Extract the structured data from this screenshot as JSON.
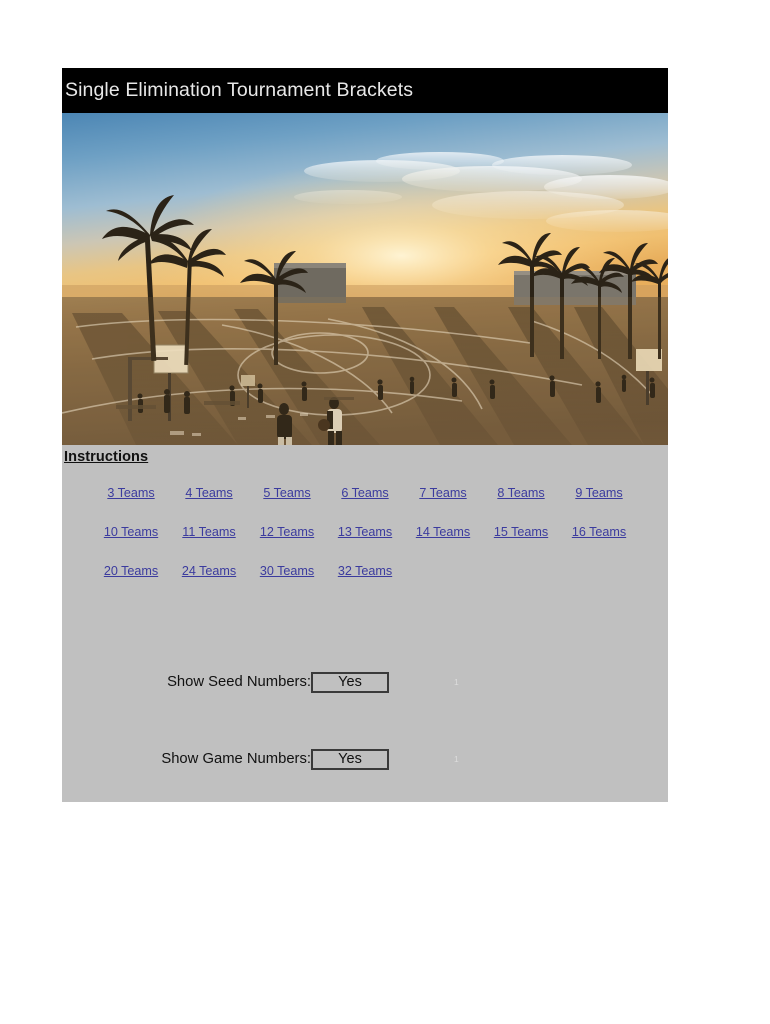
{
  "document": {
    "title": "Single Elimination Tournament Brackets",
    "background_color": "#ffffff",
    "panel_color": "#c0c0c0",
    "title_bar_color": "#000000",
    "link_color": "#3b3b9e"
  },
  "hero": {
    "alt": "Outdoor beach basketball courts at sunset with tall palm trees, long shadows across the asphalt and players on the court"
  },
  "instructions": {
    "label": "Instructions"
  },
  "bracket_links": [
    [
      {
        "label": "3 Teams"
      },
      {
        "label": "4 Teams"
      },
      {
        "label": "5 Teams"
      },
      {
        "label": "6 Teams"
      },
      {
        "label": "7 Teams"
      },
      {
        "label": "8 Teams"
      },
      {
        "label": "9 Teams"
      }
    ],
    [
      {
        "label": "10 Teams"
      },
      {
        "label": "11 Teams"
      },
      {
        "label": "12 Teams"
      },
      {
        "label": "13 Teams"
      },
      {
        "label": "14 Teams"
      },
      {
        "label": "15 Teams"
      },
      {
        "label": "16 Teams"
      }
    ],
    [
      {
        "label": "20 Teams"
      },
      {
        "label": "24 Teams"
      },
      {
        "label": "30 Teams"
      },
      {
        "label": "32 Teams"
      },
      {
        "label": ""
      },
      {
        "label": ""
      },
      {
        "label": ""
      }
    ]
  ],
  "options": [
    {
      "label": "Show Seed Numbers:",
      "value": "Yes",
      "note": "1"
    },
    {
      "label": "Show Game Numbers:",
      "value": "Yes",
      "note": "1"
    }
  ]
}
